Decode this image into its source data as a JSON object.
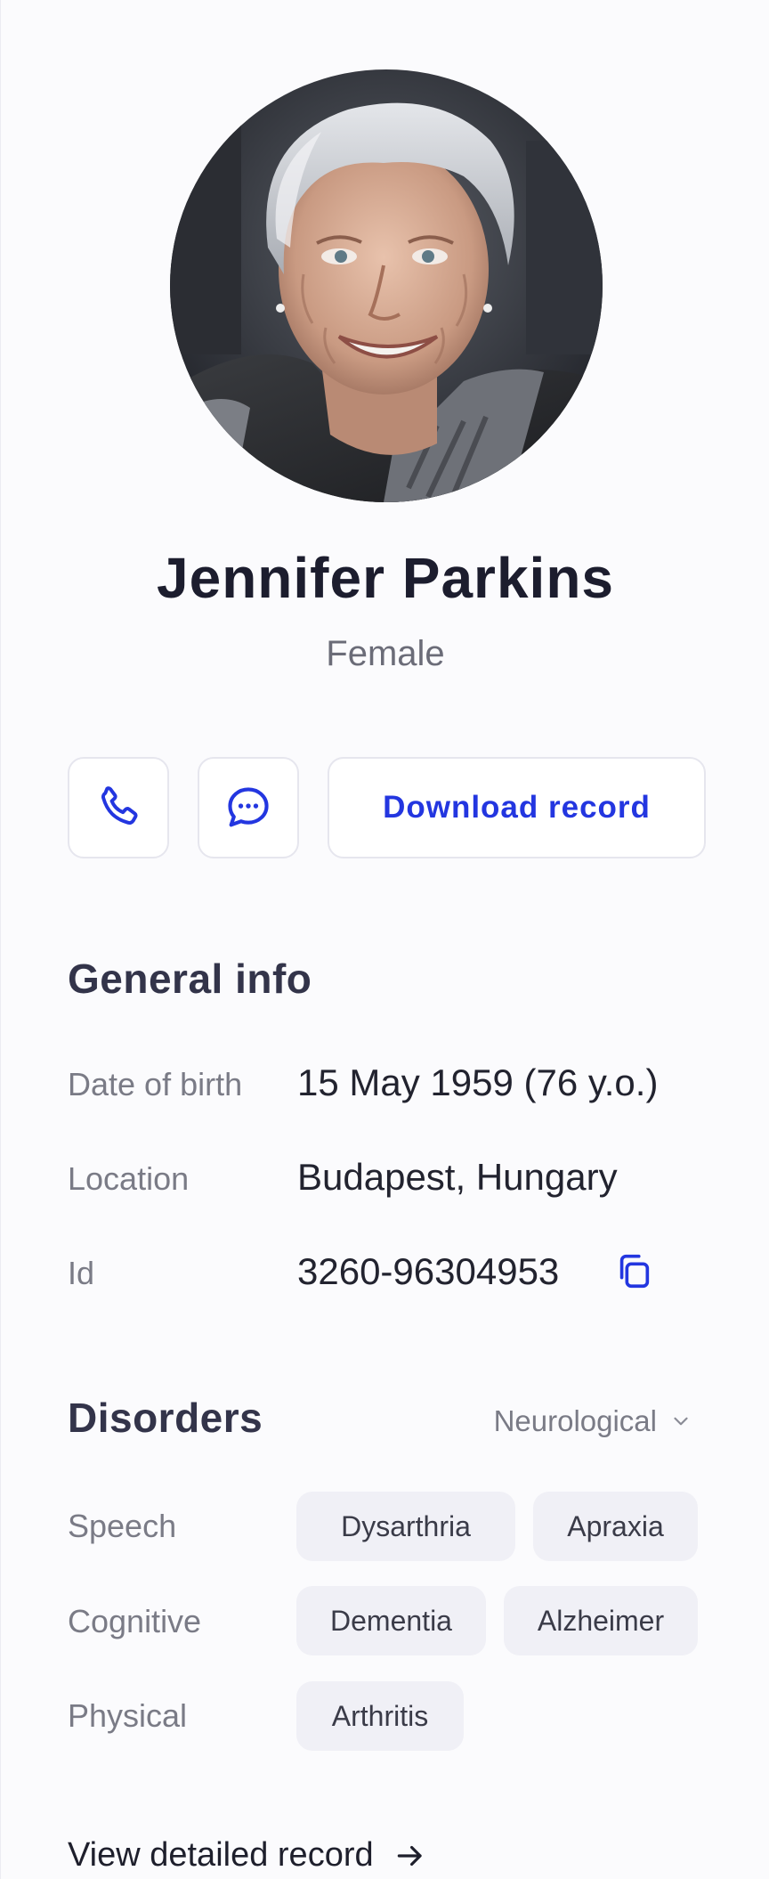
{
  "profile": {
    "name": "Jennifer Parkins",
    "gender": "Female",
    "photo_alt": "Portrait of an elderly woman with short grey hair smiling"
  },
  "actions": {
    "download_label": "Download record",
    "phone_icon": "phone-icon",
    "chat_icon": "chat-bubble-icon"
  },
  "general_info": {
    "title": "General info",
    "rows": [
      {
        "label": "Date of birth",
        "value": "15 May 1959 (76 y.o.)"
      },
      {
        "label": "Location",
        "value": "Budapest, Hungary"
      },
      {
        "label": "Id",
        "value": "3260-96304953"
      }
    ]
  },
  "disorders": {
    "title": "Disorders",
    "filter": "Neurological",
    "groups": [
      {
        "label": "Speech",
        "tags": [
          "Dysarthria",
          "Apraxia"
        ]
      },
      {
        "label": "Cognitive",
        "tags": [
          "Dementia",
          "Alzheimer"
        ]
      },
      {
        "label": "Physical",
        "tags": [
          "Arthritis"
        ]
      }
    ]
  },
  "footer": {
    "link_label": "View detailed record"
  },
  "colors": {
    "accent": "#2336e0",
    "text": "#1c1d2e",
    "muted": "#7a7b86",
    "chip_bg": "#f0f0f6"
  }
}
